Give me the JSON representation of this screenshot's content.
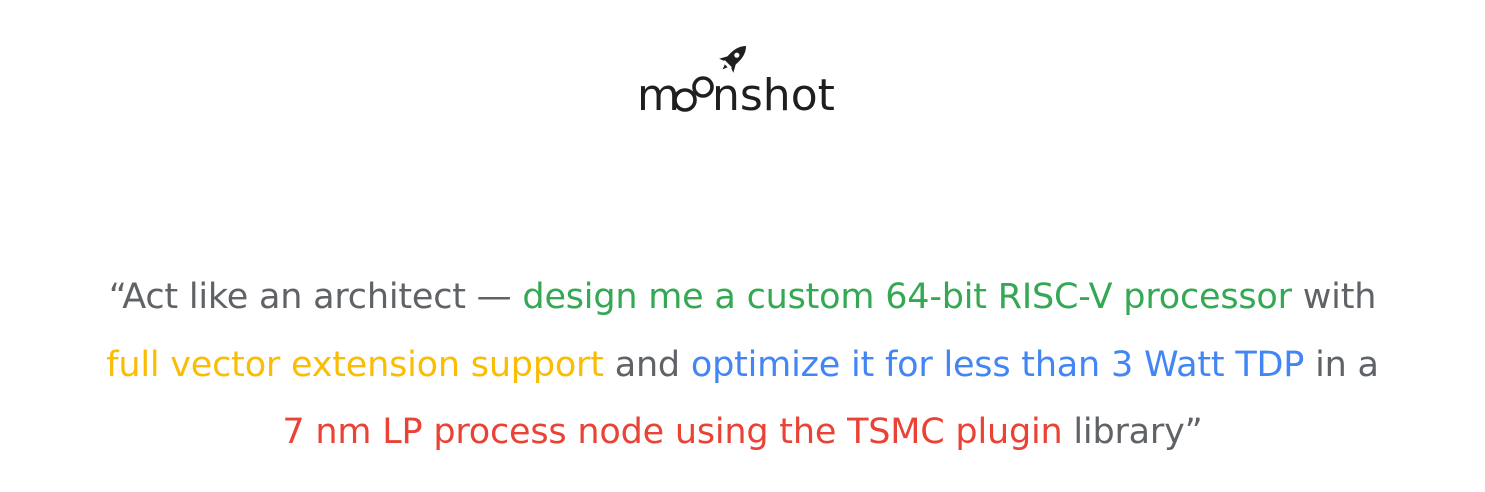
{
  "logo": {
    "text": "moonshot",
    "letters": {
      "m": "m",
      "rest": "nshot"
    },
    "icon": "rocket-icon"
  },
  "quote": {
    "lines": [
      [
        {
          "text": "“Act like an architect — ",
          "color": "gray"
        },
        {
          "text": "design me a custom 64-bit RISC-V processor",
          "color": "green"
        },
        {
          "text": " with",
          "color": "gray"
        }
      ],
      [
        {
          "text": "full vector extension support",
          "color": "yellow"
        },
        {
          "text": " and ",
          "color": "gray"
        },
        {
          "text": "optimize it for less than 3 Watt TDP",
          "color": "blue"
        },
        {
          "text": " in a",
          "color": "gray"
        }
      ],
      [
        {
          "text": "7 nm LP process node using the TSMC plugin",
          "color": "red"
        },
        {
          "text": " library”",
          "color": "gray"
        }
      ]
    ]
  },
  "colors": {
    "gray": "#5f6368",
    "green": "#34a853",
    "yellow": "#fbbc04",
    "blue": "#4285f4",
    "red": "#ea4335",
    "logo": "#1f1f1f"
  }
}
